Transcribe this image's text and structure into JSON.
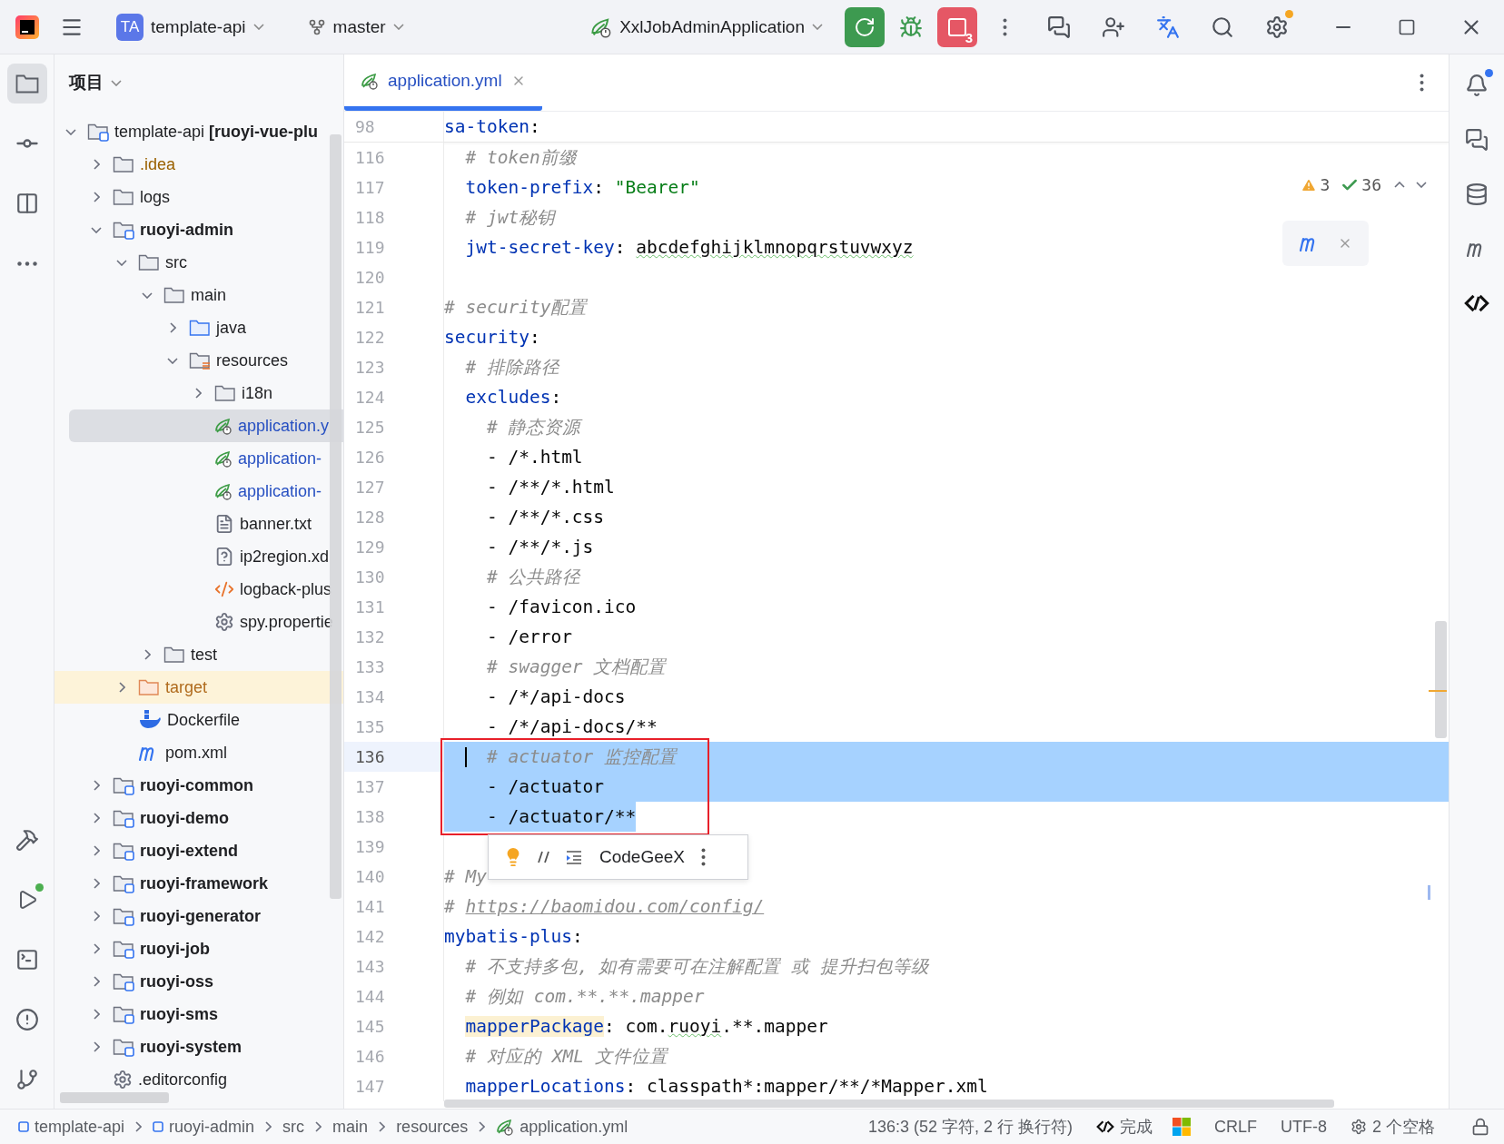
{
  "toolbar": {
    "project_badge": "TA",
    "project": "template-api",
    "branch": "master",
    "run_config": "XxlJobAdminApplication",
    "stop_count": "3"
  },
  "project_panel": {
    "title": "项目",
    "tree": [
      {
        "label": "template-api **[ruoyi-vue-plu**",
        "kind": "module",
        "expanded": true,
        "selected": false,
        "children": [
          {
            "label": ".idea",
            "kind": "ignored-folder",
            "expanded": false,
            "selected": false
          },
          {
            "label": "logs",
            "kind": "folder",
            "expanded": false,
            "selected": false
          },
          {
            "label": "ruoyi-admin",
            "kind": "module",
            "expanded": true,
            "selected": false,
            "children": [
              {
                "label": "src",
                "kind": "folder",
                "expanded": true,
                "selected": false,
                "children": [
                  {
                    "label": "main",
                    "kind": "folder",
                    "expanded": true,
                    "selected": false,
                    "children": [
                      {
                        "label": "java",
                        "kind": "source-folder",
                        "expanded": false,
                        "selected": false
                      },
                      {
                        "label": "resources",
                        "kind": "resources-folder",
                        "expanded": true,
                        "selected": false,
                        "children": [
                          {
                            "label": "i18n",
                            "kind": "folder",
                            "expanded": false,
                            "selected": false
                          },
                          {
                            "label": "application.y",
                            "kind": "spring-file",
                            "selected": true
                          },
                          {
                            "label": "application-",
                            "kind": "spring-file",
                            "selected": false
                          },
                          {
                            "label": "application-",
                            "kind": "spring-file",
                            "selected": false
                          },
                          {
                            "label": "banner.txt",
                            "kind": "text-file",
                            "selected": false
                          },
                          {
                            "label": "ip2region.xd",
                            "kind": "unknown-file",
                            "selected": false
                          },
                          {
                            "label": "logback-plus",
                            "kind": "xml-file",
                            "selected": false
                          },
                          {
                            "label": "spy.propertie",
                            "kind": "config-file",
                            "selected": false
                          }
                        ]
                      }
                    ]
                  },
                  {
                    "label": "test",
                    "kind": "folder",
                    "expanded": false,
                    "selected": false
                  }
                ]
              },
              {
                "label": "target",
                "kind": "excluded-folder",
                "expanded": false,
                "selected": false
              },
              {
                "label": "Dockerfile",
                "kind": "docker-file",
                "selected": false
              },
              {
                "label": "pom.xml",
                "kind": "maven-file",
                "selected": false
              }
            ]
          },
          {
            "label": "ruoyi-common",
            "kind": "module",
            "expanded": false,
            "selected": false
          },
          {
            "label": "ruoyi-demo",
            "kind": "module",
            "expanded": false,
            "selected": false
          },
          {
            "label": "ruoyi-extend",
            "kind": "module",
            "expanded": false,
            "selected": false
          },
          {
            "label": "ruoyi-framework",
            "kind": "module",
            "expanded": false,
            "selected": false
          },
          {
            "label": "ruoyi-generator",
            "kind": "module",
            "expanded": false,
            "selected": false
          },
          {
            "label": "ruoyi-job",
            "kind": "module",
            "expanded": false,
            "selected": false
          },
          {
            "label": "ruoyi-oss",
            "kind": "module",
            "expanded": false,
            "selected": false
          },
          {
            "label": "ruoyi-sms",
            "kind": "module",
            "expanded": false,
            "selected": false
          },
          {
            "label": "ruoyi-system",
            "kind": "module",
            "expanded": false,
            "selected": false
          },
          {
            "label": ".editorconfig",
            "kind": "config-file",
            "selected": false
          }
        ]
      }
    ]
  },
  "editor": {
    "tabs": [
      {
        "label": "application.yml",
        "selected": true
      }
    ],
    "inspections": {
      "warnings": "3",
      "passed": "36"
    },
    "sticky_line": {
      "number": "98",
      "tokens": [
        {
          "kind": "key",
          "text": "sa-token"
        },
        {
          "kind": "plain",
          "text": ":"
        }
      ],
      "children": [
        {
          "number": "116",
          "selected": false,
          "current": false,
          "boxed": false,
          "tokens": [
            {
              "kind": "comment",
              "text": "# token前缀"
            }
          ]
        },
        {
          "number": "117",
          "selected": false,
          "current": false,
          "boxed": false,
          "tokens": [
            {
              "kind": "key",
              "text": "token-prefix"
            },
            {
              "kind": "plain",
              "text": ": "
            },
            {
              "kind": "string",
              "text": "\"Bearer\""
            }
          ]
        },
        {
          "number": "118",
          "selected": false,
          "current": false,
          "boxed": false,
          "tokens": [
            {
              "kind": "comment",
              "text": "# jwt秘钥"
            }
          ]
        },
        {
          "number": "119",
          "selected": false,
          "current": false,
          "boxed": false,
          "tokens": [
            {
              "kind": "key",
              "text": "jwt-secret-key"
            },
            {
              "kind": "plain",
              "text": ": "
            },
            {
              "kind": "typo",
              "text": "abcdefghijklmnopqrstuvwxyz"
            }
          ]
        }
      ]
    },
    "lines": [
      {
        "number": "120",
        "selected": false,
        "current": false,
        "boxed": false
      },
      {
        "number": "121",
        "selected": false,
        "current": false,
        "boxed": false,
        "tokens": [
          {
            "kind": "comment",
            "text": "# security配置"
          }
        ]
      },
      {
        "number": "122",
        "selected": false,
        "current": false,
        "boxed": false,
        "tokens": [
          {
            "kind": "key",
            "text": "security"
          },
          {
            "kind": "plain",
            "text": ":"
          }
        ],
        "children": [
          {
            "number": "123",
            "selected": false,
            "current": false,
            "boxed": false,
            "tokens": [
              {
                "kind": "comment",
                "text": "# 排除路径"
              }
            ]
          },
          {
            "number": "124",
            "selected": false,
            "current": false,
            "boxed": false,
            "tokens": [
              {
                "kind": "key",
                "text": "excludes"
              },
              {
                "kind": "plain",
                "text": ":"
              }
            ],
            "children": [
              {
                "number": "125",
                "selected": false,
                "current": false,
                "boxed": false,
                "tokens": [
                  {
                    "kind": "comment",
                    "text": "# 静态资源"
                  }
                ]
              },
              {
                "number": "126",
                "selected": false,
                "current": false,
                "boxed": false,
                "tokens": [
                  {
                    "kind": "plain",
                    "text": "- /*.html"
                  }
                ]
              },
              {
                "number": "127",
                "selected": false,
                "current": false,
                "boxed": false,
                "tokens": [
                  {
                    "kind": "plain",
                    "text": "- /**/*.html"
                  }
                ]
              },
              {
                "number": "128",
                "selected": false,
                "current": false,
                "boxed": false,
                "tokens": [
                  {
                    "kind": "plain",
                    "text": "- /**/*.css"
                  }
                ]
              },
              {
                "number": "129",
                "selected": false,
                "current": false,
                "boxed": false,
                "tokens": [
                  {
                    "kind": "plain",
                    "text": "- /**/*.js"
                  }
                ]
              },
              {
                "number": "130",
                "selected": false,
                "current": false,
                "boxed": false,
                "tokens": [
                  {
                    "kind": "comment",
                    "text": "# 公共路径"
                  }
                ]
              },
              {
                "number": "131",
                "selected": false,
                "current": false,
                "boxed": false,
                "tokens": [
                  {
                    "kind": "plain",
                    "text": "- /favicon.ico"
                  }
                ]
              },
              {
                "number": "132",
                "selected": false,
                "current": false,
                "boxed": false,
                "tokens": [
                  {
                    "kind": "plain",
                    "text": "- /error"
                  }
                ]
              },
              {
                "number": "133",
                "selected": false,
                "current": false,
                "boxed": false,
                "tokens": [
                  {
                    "kind": "comment",
                    "text": "# swagger 文档配置"
                  }
                ]
              },
              {
                "number": "134",
                "selected": false,
                "current": false,
                "boxed": false,
                "tokens": [
                  {
                    "kind": "plain",
                    "text": "- /*/api-docs"
                  }
                ]
              },
              {
                "number": "135",
                "selected": false,
                "current": false,
                "boxed": false,
                "tokens": [
                  {
                    "kind": "plain",
                    "text": "- /*/api-docs/**"
                  }
                ]
              },
              {
                "number": "136",
                "selected": true,
                "current": true,
                "boxed": true,
                "tokens": [
                  {
                    "kind": "comment",
                    "text": "# actuator 监控配置"
                  }
                ]
              },
              {
                "number": "137",
                "selected": true,
                "current": false,
                "boxed": true,
                "tokens": [
                  {
                    "kind": "plain",
                    "text": "- /actuator"
                  }
                ]
              },
              {
                "number": "138",
                "selected": true,
                "current": false,
                "boxed": true,
                "tokens": [
                  {
                    "kind": "plain",
                    "text": "- /actuator/**"
                  }
                ]
              }
            ]
          }
        ]
      },
      {
        "number": "139",
        "selected": false,
        "current": false,
        "boxed": false
      },
      {
        "number": "140",
        "selected": false,
        "current": false,
        "boxed": false,
        "tokens": [
          {
            "kind": "comment",
            "text": "# My"
          }
        ]
      },
      {
        "number": "141",
        "selected": false,
        "current": false,
        "boxed": false,
        "tokens": [
          {
            "kind": "comment",
            "text": "# "
          },
          {
            "kind": "link",
            "text": "https://baomidou.com/config/"
          }
        ]
      },
      {
        "number": "142",
        "selected": false,
        "current": false,
        "boxed": false,
        "tokens": [
          {
            "kind": "key",
            "text": "mybatis-plus"
          },
          {
            "kind": "plain",
            "text": ":"
          }
        ],
        "children": [
          {
            "number": "143",
            "selected": false,
            "current": false,
            "boxed": false,
            "tokens": [
              {
                "kind": "comment",
                "text": "# 不支持多包, 如有需要可在注解配置 或 提升扫包等级"
              }
            ]
          },
          {
            "number": "144",
            "selected": false,
            "current": false,
            "boxed": false,
            "tokens": [
              {
                "kind": "comment",
                "text": "# 例如 com.**.**.mapper"
              }
            ]
          },
          {
            "number": "145",
            "selected": false,
            "current": false,
            "boxed": false,
            "tokens": [
              {
                "kind": "marked-key",
                "text": "mapperPackage"
              },
              {
                "kind": "plain",
                "text": ": com."
              },
              {
                "kind": "typo",
                "text": "ruoyi"
              },
              {
                "kind": "plain",
                "text": ".**.mapper"
              }
            ]
          },
          {
            "number": "146",
            "selected": false,
            "current": false,
            "boxed": false,
            "tokens": [
              {
                "kind": "comment",
                "text": "# 对应的 XML 文件位置"
              }
            ]
          },
          {
            "number": "147",
            "selected": false,
            "current": false,
            "boxed": false,
            "tokens": [
              {
                "kind": "key",
                "text": "mapperLocations"
              },
              {
                "kind": "plain",
                "text": ": classpath*:mapper/**/*Mapper.xml"
              }
            ]
          }
        ]
      }
    ],
    "floating_toolbar": {
      "label": "CodeGeeX"
    }
  },
  "status_bar": {
    "breadcrumbs": [
      {
        "label": "template-api",
        "kind": "module"
      },
      {
        "label": "ruoyi-admin",
        "kind": "module"
      },
      {
        "label": "src",
        "kind": "plain"
      },
      {
        "label": "main",
        "kind": "plain"
      },
      {
        "label": "resources",
        "kind": "plain"
      },
      {
        "label": "application.yml",
        "kind": "spring-file"
      }
    ],
    "position": "136:3 (52 字符, 2 行 换行符)",
    "assistant": "完成",
    "line_separator": "CRLF",
    "encoding": "UTF-8",
    "indent": "2 个空格"
  }
}
